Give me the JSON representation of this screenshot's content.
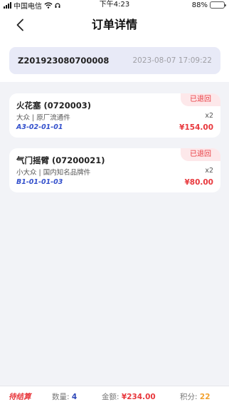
{
  "status_bar": {
    "carrier": "中国电信",
    "time": "下午4:23",
    "battery": "88%",
    "battery_level": 0.88,
    "icons": [
      "signal-icon",
      "wifi-icon",
      "headset-icon",
      "battery-icon"
    ]
  },
  "nav": {
    "title": "订单详情",
    "back_icon": "chevron-left-icon"
  },
  "order": {
    "number": "Z201923080700008",
    "time": "2023-08-07 17:09:22"
  },
  "items": [
    {
      "name": "火花塞 (0720003)",
      "desc": "大众 | 原厂流通件",
      "code": "A3-02-01-01",
      "qty": "x2",
      "price": "¥154.00",
      "badge": "已退回"
    },
    {
      "name": "气门摇臂 (07200021)",
      "desc": "小大众 | 国内知名品牌件",
      "code": "B1-01-01-03",
      "qty": "x2",
      "price": "¥80.00",
      "badge": "已退回"
    }
  ],
  "summary": {
    "status": "待结算",
    "qty_label": "数量:",
    "qty_value": "4",
    "amount_label": "金额:",
    "amount_value": "¥234.00",
    "points_label": "积分:",
    "points_value": "22"
  },
  "colors": {
    "accent_red": "#e8383d",
    "code_blue": "#3350cc",
    "points_orange": "#f2a12f",
    "order_box_bg": "#e8eaf7",
    "page_bg": "#f2f3f7"
  }
}
